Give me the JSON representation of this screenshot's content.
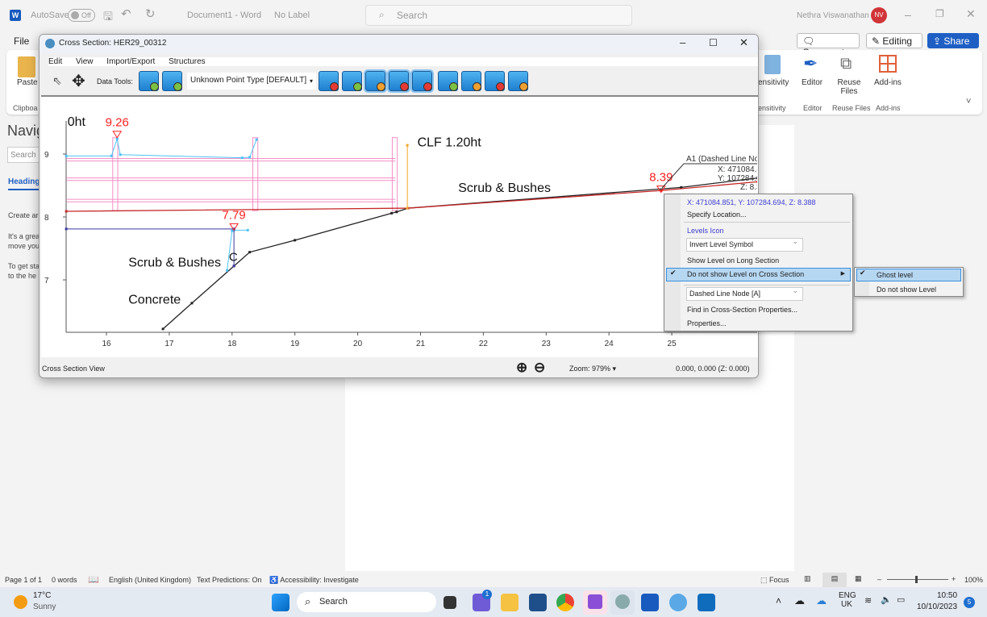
{
  "word": {
    "autosave": "AutoSave",
    "autosave_state": "Off",
    "doc_title": "Document1 - Word",
    "label": "No Label",
    "search_placeholder": "Search",
    "user": "Nethra Viswanathan",
    "user_initials": "NV",
    "file_tab": "File",
    "comments": "Comments",
    "editing": "Editing",
    "share": "Share",
    "ribbon": {
      "paste": "Paste",
      "clipboard": "Clipboa",
      "sensitivity": "ensitivity",
      "sensitivity_group": "ensitivity",
      "editor": "Editor",
      "editor_group": "Editor",
      "reuse": "Reuse Files",
      "reuse_l1": "Reuse",
      "reuse_l2": "Files",
      "reuse_group": "Reuse Files",
      "addins": "Add-ins",
      "addins_group": "Add-ins"
    },
    "nav": {
      "title": "Navig",
      "search": "Search d",
      "headings": "Heading",
      "p1": "Create ar",
      "p2a": "It's a grea",
      "p2b": "move you",
      "p3a": "To get sta",
      "p3b": "to the he"
    },
    "status": {
      "page": "Page 1 of 1",
      "words": "0 words",
      "language": "English (United Kingdom)",
      "predictions": "Text Predictions: On",
      "accessibility": "Accessibility: Investigate",
      "focus": "Focus",
      "zoom": "100%"
    }
  },
  "taskbar": {
    "temp": "17°C",
    "weather": "Sunny",
    "search": "Search",
    "chat_badge": "1",
    "lang1": "ENG",
    "lang2": "UK",
    "time": "10:50",
    "date": "10/10/2023",
    "notif": "5"
  },
  "xs": {
    "title": "Cross Section: HER29_00312",
    "menu": [
      "Edit",
      "View",
      "Import/Export",
      "Structures"
    ],
    "data_tools_label": "Data Tools:",
    "point_type": "Unknown Point Type [DEFAULT]",
    "status_left": "Cross Section View",
    "zoom": "Zoom: 979%",
    "coords": "0.000, 0.000 (Z: 0.000)"
  },
  "context_menu": {
    "coords": "X: 471084.851, Y: 107284.694, Z: 8.388",
    "specify": "Specify Location...",
    "levels_icon": "Levels Icon",
    "invert": "Invert Level Symbol",
    "show_long": "Show Level on Long Section",
    "no_show_cross": "Do not show Level on Cross Section",
    "node": "Dashed Line Node [A]",
    "find": "Find in Cross-Section Properties...",
    "properties": "Properties...",
    "submenu": [
      "Ghost level",
      "Do not show Level"
    ]
  },
  "chart_data": {
    "type": "line",
    "xlim": [
      15.36,
      26.37
    ],
    "ylim": [
      6.2,
      9.65
    ],
    "xticks": [
      16,
      17,
      18,
      19,
      20,
      21,
      22,
      23,
      24,
      25
    ],
    "yticks": [
      7,
      8,
      9
    ],
    "series": [
      {
        "color": "#222222",
        "points": [
          [
            16.9,
            6.22
          ],
          [
            17.36,
            6.63
          ],
          [
            18.03,
            7.22
          ],
          [
            18.28,
            7.44
          ],
          [
            19.0,
            7.63
          ],
          [
            20.54,
            8.06
          ],
          [
            20.62,
            8.08
          ],
          [
            20.8,
            8.14
          ],
          [
            25.15,
            8.47
          ],
          [
            26.37,
            8.62
          ]
        ]
      },
      {
        "color": "#c62828",
        "points": [
          [
            15.36,
            8.09
          ],
          [
            20.8,
            8.14
          ],
          [
            24.83,
            8.42
          ],
          [
            26.37,
            8.56
          ]
        ]
      },
      {
        "color": "#4fc3f7",
        "points": [
          [
            15.36,
            8.97
          ],
          [
            16.08,
            8.97
          ],
          [
            16.17,
            9.24
          ],
          [
            16.22,
            8.99
          ],
          [
            18.16,
            8.94
          ],
          [
            18.28,
            8.95
          ],
          [
            18.39,
            9.23
          ]
        ]
      },
      {
        "color": "#4fc3f7",
        "points": [
          [
            18.03,
            7.79
          ],
          [
            18.25,
            7.79
          ]
        ]
      },
      {
        "color": "#4fc3f7",
        "points": [
          [
            18.0,
            7.78
          ],
          [
            17.92,
            7.15
          ]
        ]
      },
      {
        "color": "#3a3aa0",
        "points": [
          [
            15.36,
            7.81
          ],
          [
            18.03,
            7.81
          ],
          [
            18.03,
            7.22
          ]
        ]
      },
      {
        "color": "#f5a623",
        "points": [
          [
            20.79,
            9.14
          ],
          [
            20.79,
            8.14
          ]
        ]
      }
    ],
    "fence": {
      "color": "#f48fc7",
      "rails": [
        8.93,
        8.89,
        8.62,
        8.58,
        8.28,
        8.24
      ],
      "rail_range": [
        15.36,
        20.6
      ],
      "posts": [
        [
          16.1,
          16.18
        ],
        [
          18.33,
          18.41
        ],
        [
          20.55,
          20.63
        ]
      ],
      "post_top": 9.26
    },
    "levels": [
      {
        "x": 16.17,
        "y": 9.26,
        "label": "9.26"
      },
      {
        "x": 18.03,
        "y": 7.79,
        "label": "7.79"
      },
      {
        "x": 24.83,
        "y": 8.39,
        "label": "8.39"
      }
    ],
    "annotations": [
      {
        "text": "0ht",
        "x": 15.38,
        "y": 9.45
      },
      {
        "text": "CLF 1.20ht",
        "x": 20.95,
        "y": 9.12
      },
      {
        "text": "Scrub & Bushes",
        "x": 21.6,
        "y": 8.4
      },
      {
        "text": "Scrub & Bushes",
        "x": 16.35,
        "y": 7.21
      },
      {
        "text": "Concrete",
        "x": 16.35,
        "y": 6.62
      },
      {
        "text": "C",
        "x": 17.95,
        "y": 7.3
      }
    ],
    "callout": {
      "title": "A1 (Dashed Line No",
      "x": "X: 471084.8",
      "y": "Y: 107284.6",
      "z": "Z: 8.3"
    }
  }
}
